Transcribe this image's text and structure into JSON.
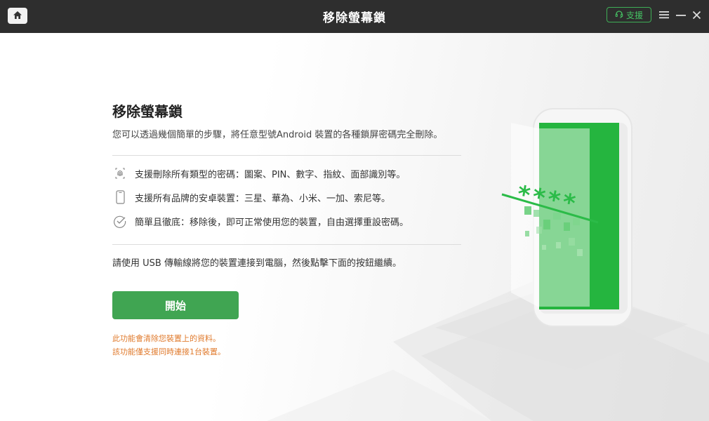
{
  "window": {
    "title": "移除螢幕鎖",
    "support_label": "支援"
  },
  "icons": {
    "home": "home-icon",
    "headset": "headset-icon",
    "menu": "hamburger-menu-icon",
    "minimize": "minimize-icon",
    "close": "close-icon",
    "fingerprint": "fingerprint-icon",
    "phone": "phone-icon",
    "check": "check-circle-icon"
  },
  "colors": {
    "titlebar": "#2e2e2e",
    "accent_green": "#40a552",
    "warning_orange": "#e07b2e"
  },
  "main": {
    "heading": "移除螢幕鎖",
    "subtitle": "您可以透過幾個簡單的步驟，將任意型號Android 裝置的各種鎖屏密碼完全刪除。",
    "features": [
      {
        "text": "支援刪除所有類型的密碼：圖案、PIN、數字、指紋、面部識別等。"
      },
      {
        "text": "支援所有品牌的安卓裝置：三星、華為、小米、一加、索尼等。"
      },
      {
        "text": "簡單且徹底：移除後，即可正常使用您的裝置，自由選擇重設密碼。"
      }
    ],
    "instruction": "請使用 USB 傳輸線將您的裝置連接到電腦，然後點擊下面的按鈕繼續。",
    "start_label": "開始",
    "warnings": [
      "此功能會清除您裝置上的資料。",
      "該功能僅支援同時連接1台裝置。"
    ]
  },
  "illustration": {
    "password_mask": "****"
  }
}
